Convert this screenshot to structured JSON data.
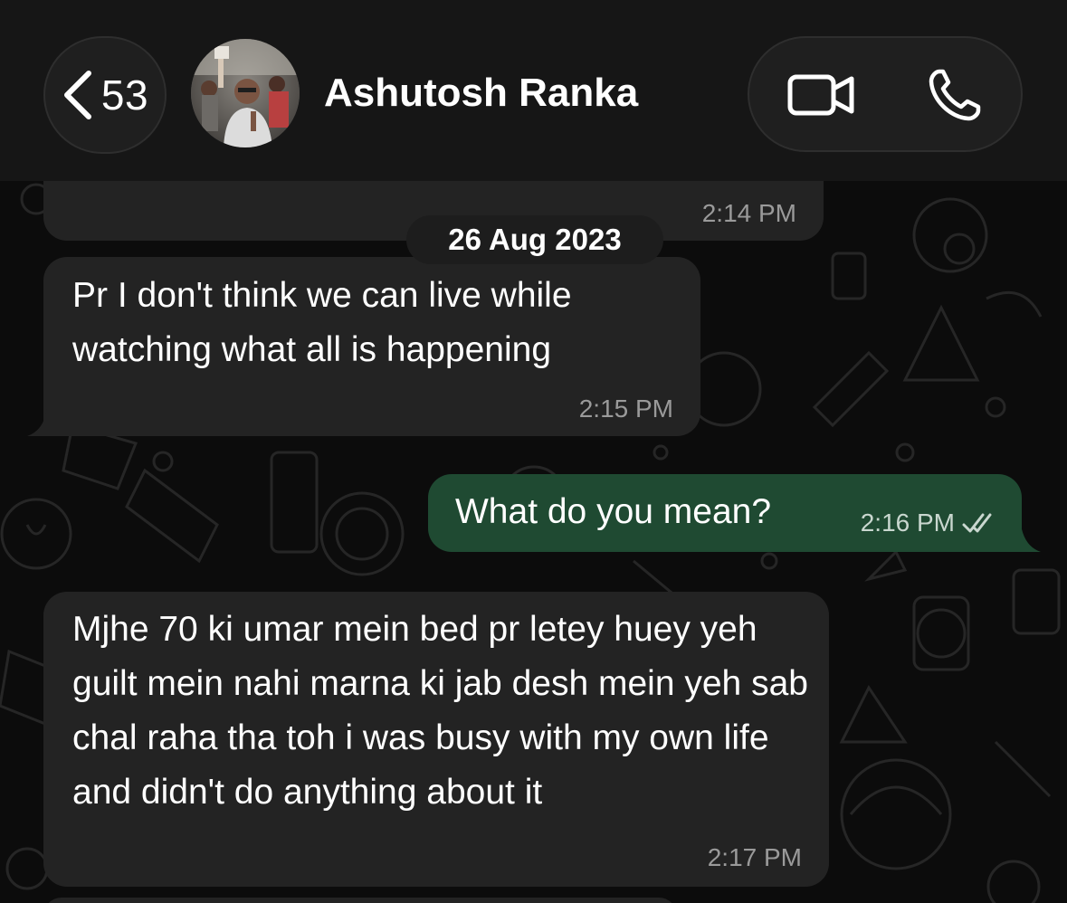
{
  "header": {
    "back_count": "53",
    "contact_name": "Ashutosh Ranka"
  },
  "date_separator": "26 Aug 2023",
  "messages": [
    {
      "direction": "incoming",
      "text": "",
      "time": "2:14 PM"
    },
    {
      "direction": "incoming",
      "text": "Pr I don't think we can live while watching what all is happening",
      "time": "2:15 PM"
    },
    {
      "direction": "outgoing",
      "text": "What do you mean?",
      "time": "2:16 PM",
      "status": "read-double-check-icon"
    },
    {
      "direction": "incoming",
      "text": "Mjhe 70 ki umar mein bed pr letey huey yeh guilt mein nahi marna ki jab desh mein yeh sab chal raha tha toh i was busy with my own life and didn't do anything about it",
      "time": "2:17 PM"
    }
  ],
  "colors": {
    "header_bg": "#161616",
    "incoming_bubble": "#232323",
    "outgoing_bubble": "#1f4a32",
    "wallpaper_doodle": "#2a2a2a"
  },
  "icons": {
    "back": "chevron-left-icon",
    "video": "video-camera-icon",
    "call": "phone-icon",
    "read_receipt": "double-check-icon"
  }
}
